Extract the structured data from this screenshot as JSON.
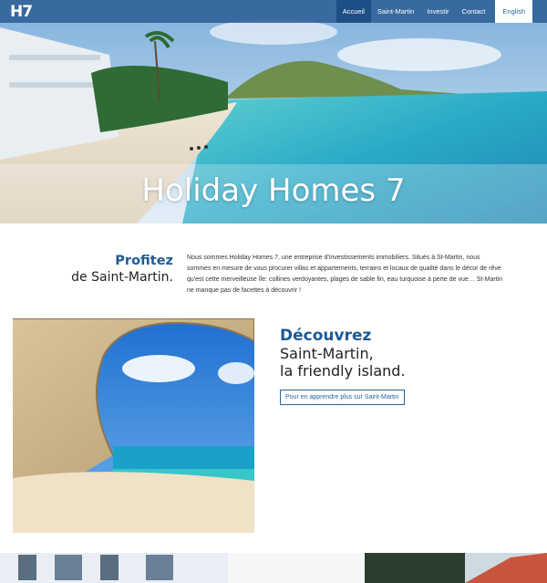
{
  "nav": {
    "logo": "H7",
    "items": [
      {
        "label": "Accueil",
        "active": true
      },
      {
        "label": "Saint-Martin"
      },
      {
        "label": "Investir"
      },
      {
        "label": "Contact"
      }
    ],
    "language": "English"
  },
  "hero": {
    "title": "Holiday Homes 7"
  },
  "intro": {
    "heading_highlight": "Profitez",
    "heading_rest": "de Saint-Martin.",
    "paragraph": "Nous sommes Holiday Homes 7, une entreprise d'investissements immobiliers. Situés à St-Martin, nous sommes en mesure de vous procurer villas et appartements, terrains et locaux de qualité dans le décor de rêve qu'est cette merveilleuse île: collines verdoyantes, plages de sable fin, eau turquoise à perte de vue… St-Martin ne manque pas de facettes à découvrir !"
  },
  "discover": {
    "heading_highlight": "Découvrez",
    "line1": "Saint-Martin,",
    "line2": "la friendly island.",
    "button": "Pour en apprendre plus sur Saint-Martin"
  },
  "colors": {
    "nav": "#2d5f96",
    "accent": "#1c5a96",
    "nav_active": "#1d4f86"
  }
}
